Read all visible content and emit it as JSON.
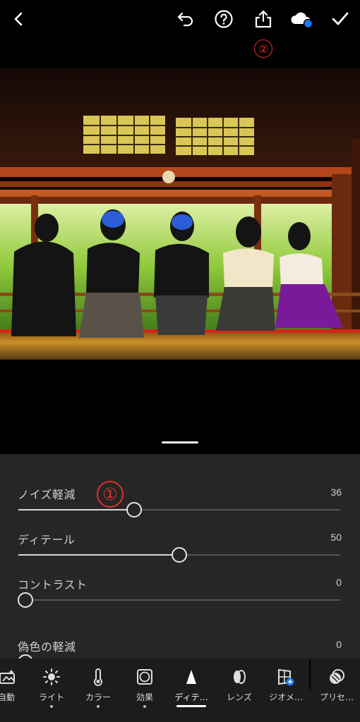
{
  "topbar": {
    "icons": [
      "back-chevron-icon",
      "undo-icon",
      "help-icon",
      "share-icon",
      "cloud-sync-icon",
      "done-check-icon"
    ],
    "annotation": "②",
    "cloud_status_color": "#1e78ff"
  },
  "panel": {
    "sliders": [
      {
        "label": "ノイズ軽減",
        "value": "36",
        "level": 36
      },
      {
        "label": "ディテール",
        "value": "50",
        "level": 50
      },
      {
        "label": "コントラスト",
        "value": "0",
        "level": 0
      },
      {
        "label": "偽色の軽減",
        "value": "0",
        "level": 0
      }
    ],
    "annotation": "①"
  },
  "toolbar": {
    "items": [
      {
        "label": "自動",
        "icon": "auto-icon"
      },
      {
        "label": "ライト",
        "icon": "sun-icon"
      },
      {
        "label": "カラー",
        "icon": "thermometer-icon"
      },
      {
        "label": "効果",
        "icon": "vignette-icon"
      },
      {
        "label": "ディテ…",
        "icon": "triangle-icon",
        "active": true
      },
      {
        "label": "レンズ",
        "icon": "lens-icon"
      },
      {
        "label": "ジオメ…",
        "icon": "geometry-icon"
      },
      {
        "label": "プリセ…",
        "icon": "presets-icon"
      }
    ]
  },
  "colors": {
    "annotation_red": "#e0302a",
    "panel_bg": "#262626",
    "toolbar_bg": "#1c1c1c"
  }
}
